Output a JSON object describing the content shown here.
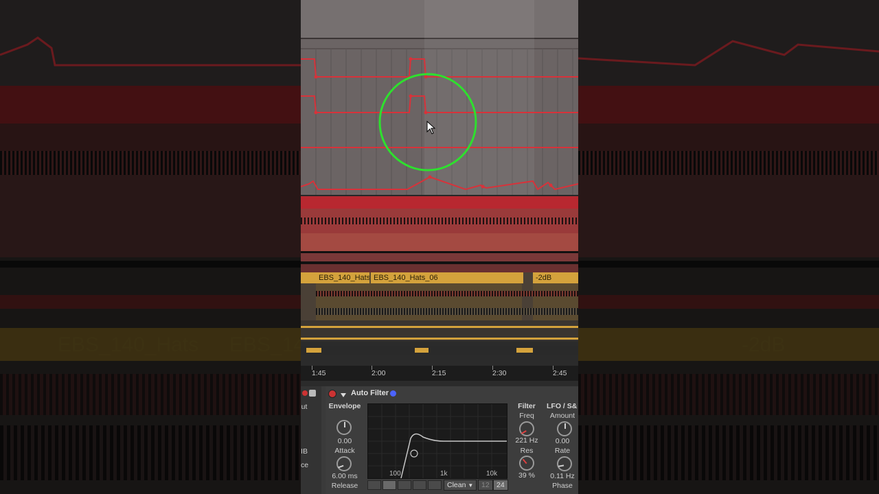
{
  "arrangement": {
    "clips": [
      {
        "name": "EBS_140_Hats"
      },
      {
        "name": "EBS_140_Hats_06"
      },
      {
        "name": "-2dB"
      }
    ]
  },
  "ruler": {
    "ticks": [
      "1:45",
      "2:00",
      "2:15",
      "2:30",
      "2:45"
    ]
  },
  "background": {
    "clip_left_1": "EBS_140_Hats",
    "clip_left_2": "EBS_14",
    "clip_right": "-2dB"
  },
  "device": {
    "title": "Auto Filter",
    "side_labels": [
      "ut",
      "IB",
      "ce"
    ],
    "envelope": {
      "section": "Envelope",
      "amount_value": "0.00",
      "attack_label": "Attack",
      "attack_value": "6.00 ms",
      "release_label": "Release"
    },
    "filter_display": {
      "freq_labels": [
        "100",
        "1k",
        "10k"
      ],
      "circuit": "Clean",
      "slope_options": [
        "12",
        "24"
      ]
    },
    "filter": {
      "section": "Filter",
      "freq_label": "Freq",
      "freq_value": "221 Hz",
      "res_label": "Res",
      "res_value": "39 %"
    },
    "lfo": {
      "section": "LFO / S&",
      "amount_label": "Amount",
      "amount_value": "0.00",
      "rate_label": "Rate",
      "rate_value": "0.11 Hz",
      "phase_label": "Phase"
    }
  },
  "colors": {
    "automation_red": "#d8323a",
    "clip_gold": "#d4a23c",
    "highlight_green": "#2ee02e",
    "device_blue": "#4b63ff"
  }
}
